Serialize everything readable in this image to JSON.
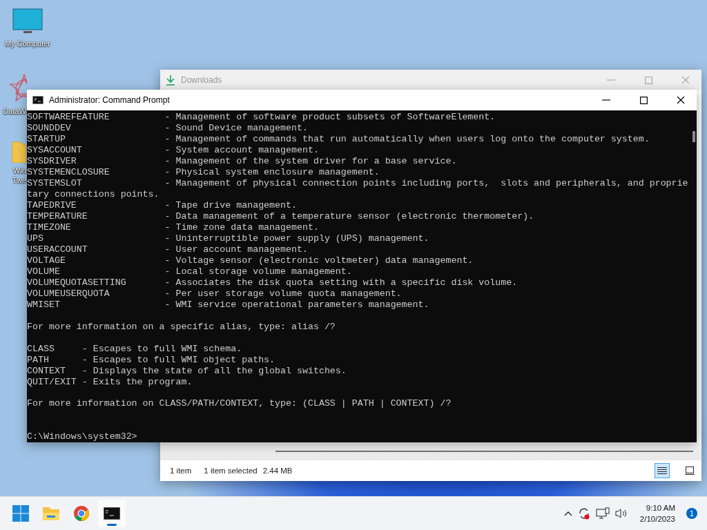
{
  "desktop_icons": [
    {
      "label": "My Computer",
      "kind": "monitor"
    },
    {
      "label": "DataW",
      "kind": "star"
    },
    {
      "label": "Win\nTwe",
      "kind": "folder"
    }
  ],
  "downloads_window": {
    "title": "Downloads",
    "status_items": [
      "1 item",
      "1 item selected",
      "2.44 MB"
    ],
    "views": [
      {
        "kind": "details",
        "selected": true
      },
      {
        "kind": "tiles",
        "selected": false
      }
    ]
  },
  "console_window": {
    "title": "Administrator:  Command Prompt",
    "lines": [
      {
        "kind": "text",
        "text": "SOFTWAREFEATURE          - Management of software product subsets of SoftwareElement."
      },
      {
        "kind": "text",
        "text": "SOUNDDEV                 - Sound Device management."
      },
      {
        "kind": "text",
        "text": "STARTUP                  - Management of commands that run automatically when users log onto the computer system."
      },
      {
        "kind": "text",
        "text": "SYSACCOUNT               - System account management."
      },
      {
        "kind": "text",
        "text": "SYSDRIVER                - Management of the system driver for a base service."
      },
      {
        "kind": "text",
        "text": "SYSTEMENCLOSURE          - Physical system enclosure management."
      },
      {
        "kind": "text",
        "text": "SYSTEMSLOT               - Management of physical connection points including ports,  slots and peripherals, and proprie"
      },
      {
        "kind": "text",
        "text": "tary connections points."
      },
      {
        "kind": "text",
        "text": "TAPEDRIVE                - Tape drive management."
      },
      {
        "kind": "text",
        "text": "TEMPERATURE              - Data management of a temperature sensor (electronic thermometer)."
      },
      {
        "kind": "text",
        "text": "TIMEZONE                 - Time zone data management."
      },
      {
        "kind": "text",
        "text": "UPS                      - Uninterruptible power supply (UPS) management."
      },
      {
        "kind": "text",
        "text": "USERACCOUNT              - User account management."
      },
      {
        "kind": "text",
        "text": "VOLTAGE                  - Voltage sensor (electronic voltmeter) data management."
      },
      {
        "kind": "text",
        "text": "VOLUME                   - Local storage volume management."
      },
      {
        "kind": "text",
        "text": "VOLUMEQUOTASETTING       - Associates the disk quota setting with a specific disk volume."
      },
      {
        "kind": "text",
        "text": "VOLUMEUSERQUOTA          - Per user storage volume quota management."
      },
      {
        "kind": "text",
        "text": "WMISET                   - WMI service operational parameters management."
      },
      {
        "kind": "blank"
      },
      {
        "kind": "text",
        "text": "For more information on a specific alias, type: alias /?"
      },
      {
        "kind": "blank"
      },
      {
        "kind": "text",
        "text": "CLASS     - Escapes to full WMI schema."
      },
      {
        "kind": "text",
        "text": "PATH      - Escapes to full WMI object paths."
      },
      {
        "kind": "text",
        "text": "CONTEXT   - Displays the state of all the global switches."
      },
      {
        "kind": "text",
        "text": "QUIT/EXIT - Exits the program."
      },
      {
        "kind": "blank"
      },
      {
        "kind": "text",
        "text": "For more information on CLASS/PATH/CONTEXT, type: (CLASS | PATH | CONTEXT) /?"
      },
      {
        "kind": "blank"
      },
      {
        "kind": "blank"
      },
      {
        "kind": "text",
        "text": "C:\\Windows\\system32>"
      }
    ]
  },
  "taskbar": {
    "apps": [
      {
        "kind": "start",
        "active": false
      },
      {
        "kind": "explorer",
        "active": false
      },
      {
        "kind": "chrome",
        "active": false
      },
      {
        "kind": "terminal",
        "active": true
      }
    ],
    "time": "9:10 AM",
    "date": "2/10/2023",
    "notification_count": "1"
  }
}
